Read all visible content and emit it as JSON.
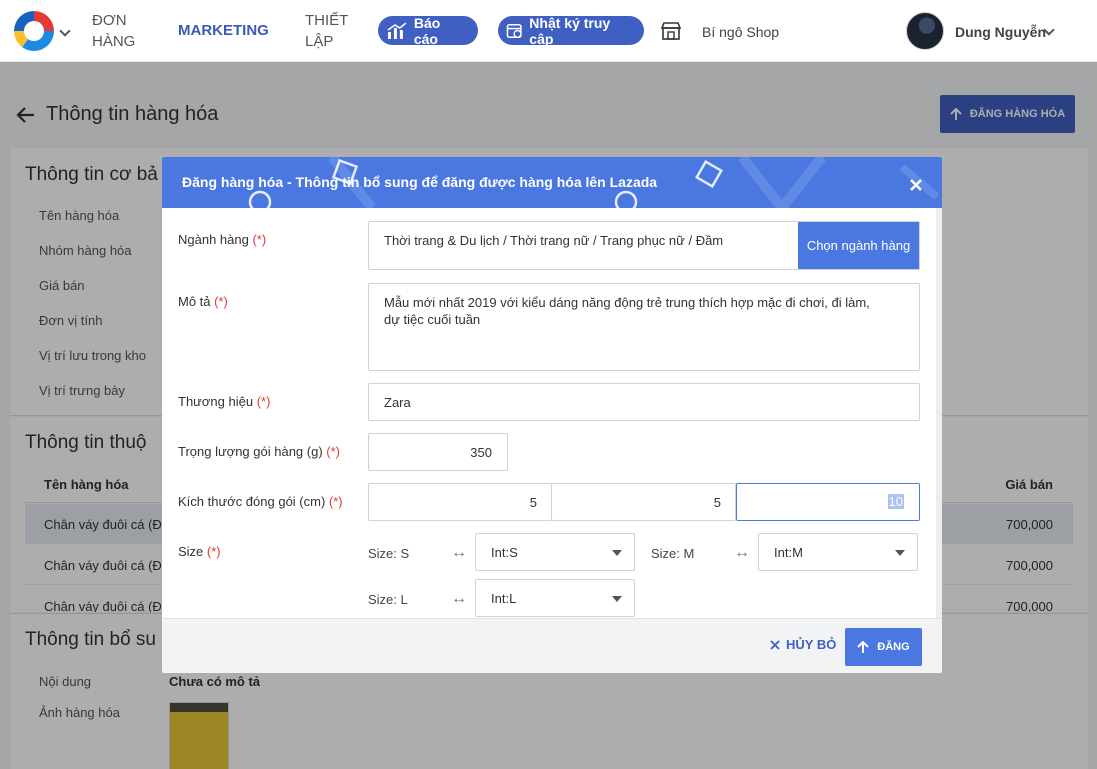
{
  "topbar": {
    "nav": [
      "ĐƠN HÀNG",
      "MARKETING",
      "THIẾT LẬP"
    ],
    "report_label": "Báo cáo",
    "log_label": "Nhật ký truy cập",
    "shop_name": "Bí ngô Shop",
    "user_name": "Dung Nguyễn"
  },
  "page": {
    "title": "Thông tin hàng hóa",
    "publish_button": "ĐĂNG HÀNG HÓA",
    "basic_section": "Thông tin cơ bả",
    "basic_labels": [
      "Tên hàng hóa",
      "Nhóm hàng hóa",
      "Giá bán",
      "Đơn vị tính",
      "Vị trí lưu trong kho",
      "Vị trí trưng bày"
    ],
    "attr_section": "Thông tin thuộ",
    "table_headers": [
      "Tên hàng hóa",
      "Giá bán"
    ],
    "table_rows": [
      {
        "name": "Chân váy đuôi cá (Đe",
        "price": "700,000"
      },
      {
        "name": "Chân váy đuôi cá (Đe",
        "price": "700,000"
      },
      {
        "name": "Chân váy đuôi cá (Đe",
        "price": "700,000"
      }
    ],
    "extra_section": "Thông tin bổ su",
    "content_label": "Nội dung",
    "content_value": "Chưa có mô tả",
    "image_label": "Ảnh hàng hóa"
  },
  "modal": {
    "title": "Đăng hàng hóa - Thông tin bổ sung để đăng được hàng hóa lên Lazada",
    "required_mark": "(*)",
    "category": {
      "label": "Ngành hàng",
      "value": "Thời trang & Du lịch / Thời trang nữ / Trang phục nữ / Đầm",
      "button": "Chọn ngành hàng"
    },
    "description": {
      "label": "Mô tả",
      "value": "Mẫu mới nhất 2019 với kiểu dáng năng động trẻ trung thích hợp mặc đi chơi, đi làm, dự tiệc cuối tuần"
    },
    "brand": {
      "label": "Thương hiệu",
      "value": "Zara"
    },
    "weight": {
      "label": "Trọng lượng gói hàng (g)",
      "value": "350"
    },
    "dimensions": {
      "label": "Kích thước đóng gói (cm)",
      "values": [
        "5",
        "5",
        "10"
      ]
    },
    "size": {
      "label": "Size",
      "mappings": [
        {
          "from": "Size: S",
          "to": "Int:S"
        },
        {
          "from": "Size: M",
          "to": "Int:M"
        },
        {
          "from": "Size: L",
          "to": "Int:L"
        }
      ]
    },
    "cancel_label": "HỦY BỎ",
    "submit_label": "ĐĂNG"
  },
  "colors": {
    "primary": "#4a78e0",
    "brand_nav": "#3f5fc2",
    "required": "#e53935"
  }
}
